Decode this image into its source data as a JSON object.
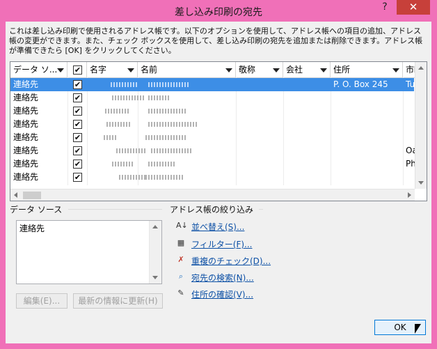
{
  "window": {
    "title": "差し込み印刷の宛先",
    "help_glyph": "?",
    "close_glyph": "✕"
  },
  "description": "これは差し込み印刷で使用されるアドレス帳です。以下のオプションを使用して、アドレス帳への項目の追加、アドレス帳の変更ができます。また、チェック ボックスを使用して、差し込み印刷の宛先を追加または削除できます。アドレス帳が準備できたら [OK] をクリックしてください。",
  "grid": {
    "columns": [
      "データ ソ...",
      "",
      "名字",
      "名前",
      "敬称",
      "会社",
      "住所",
      "市町"
    ],
    "header_check": "✔",
    "rows": [
      {
        "source": "連絡先",
        "checked": "✔",
        "address": "P. O. Box 245",
        "city": "Tu",
        "selected": true
      },
      {
        "source": "連絡先",
        "checked": "✔",
        "address": "",
        "city": ""
      },
      {
        "source": "連絡先",
        "checked": "✔",
        "address": "",
        "city": ""
      },
      {
        "source": "連絡先",
        "checked": "✔",
        "address": "",
        "city": ""
      },
      {
        "source": "連絡先",
        "checked": "✔",
        "address": "",
        "city": ""
      },
      {
        "source": "連絡先",
        "checked": "✔",
        "address": "",
        "city": "Oa"
      },
      {
        "source": "連絡先",
        "checked": "✔",
        "address": "",
        "city": "Ph"
      },
      {
        "source": "連絡先",
        "checked": "✔",
        "address": "",
        "city": ""
      }
    ]
  },
  "data_source": {
    "label": "データ ソース",
    "items": [
      "連絡先"
    ],
    "edit_button": "編集(E)...",
    "refresh_button": "最新の情報に更新(H)"
  },
  "refine": {
    "label": "アドレス帳の絞り込み",
    "links": [
      {
        "label": "並べ替え(S)...",
        "icon": "sort-icon",
        "glyph": "A↓"
      },
      {
        "label": "フィルター(F)...",
        "icon": "filter-icon",
        "glyph": "▦"
      },
      {
        "label": "重複のチェック(D)...",
        "icon": "duplicate-icon",
        "glyph": "✗"
      },
      {
        "label": "宛先の検索(N)...",
        "icon": "find-recipient-icon",
        "glyph": "⌕"
      },
      {
        "label": "住所の確認(V)...",
        "icon": "validate-address-icon",
        "glyph": "✎"
      }
    ]
  },
  "ok_button": "OK",
  "colors": {
    "title_bar": "#f070b8",
    "selection": "#3d8ee6",
    "close": "#c7403a",
    "link": "#0b4fa5"
  }
}
